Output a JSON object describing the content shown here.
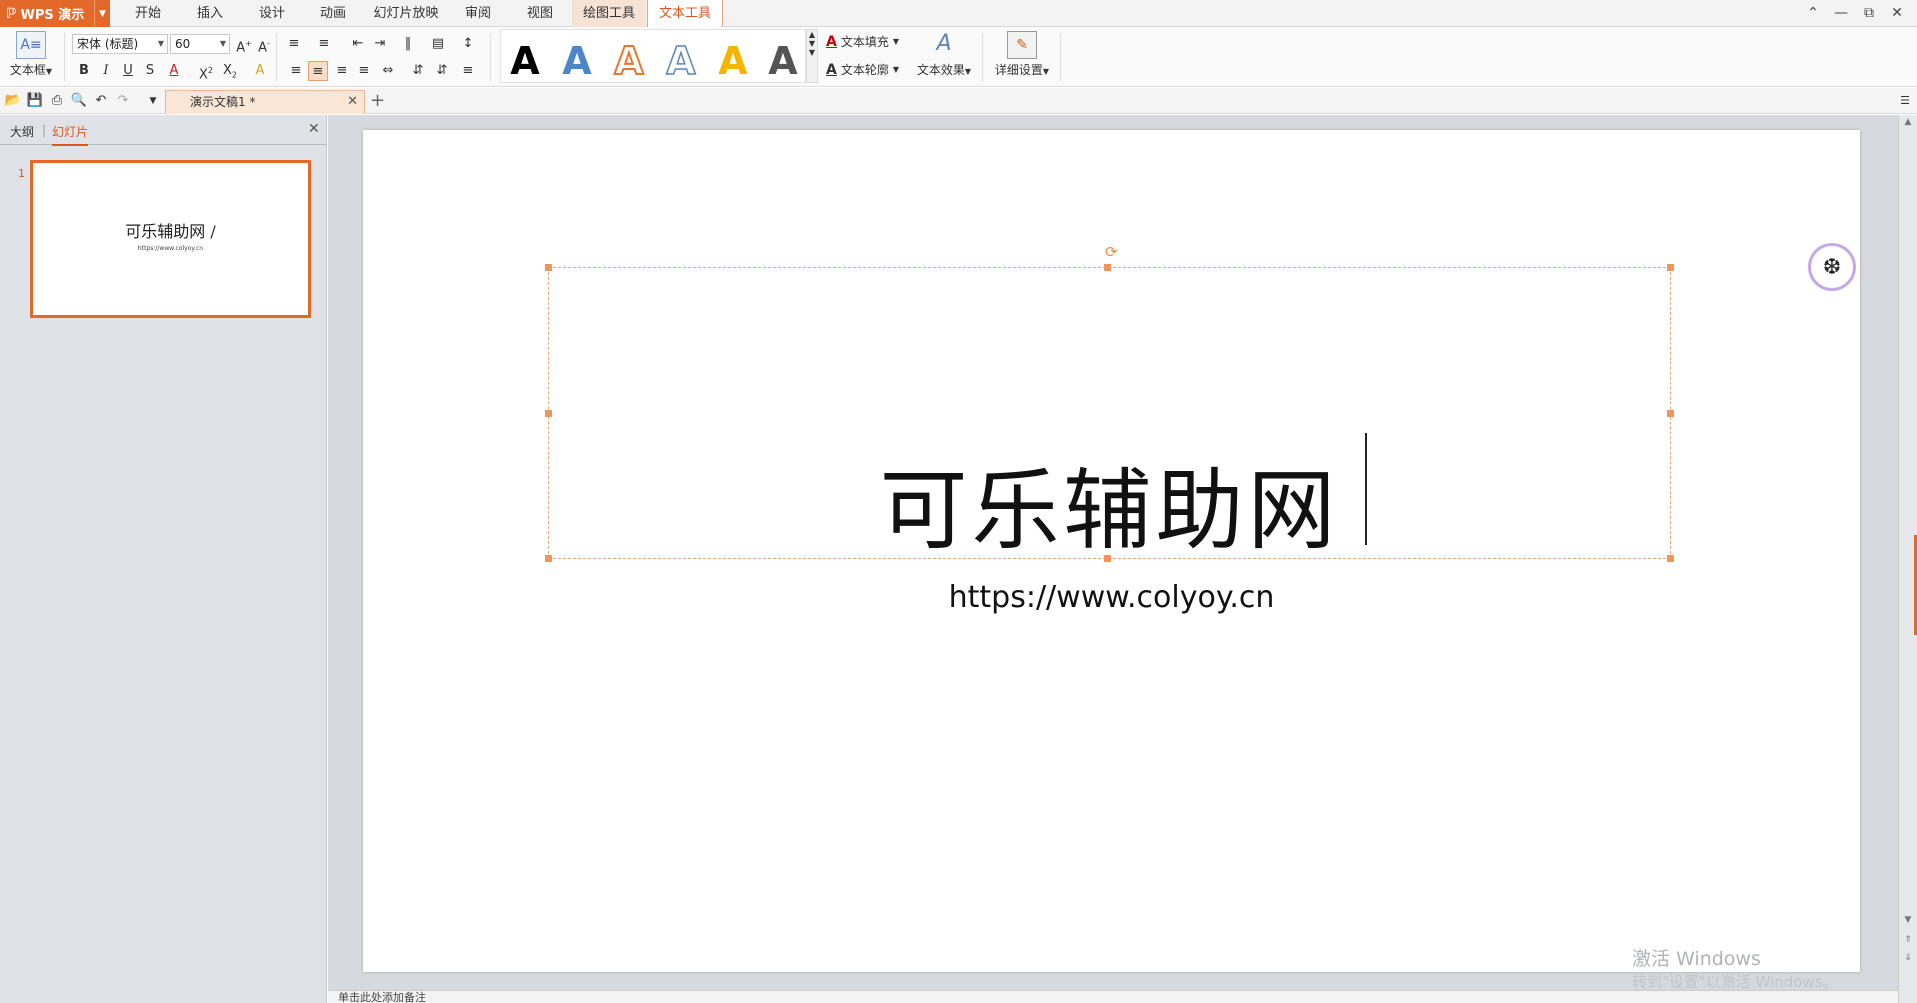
{
  "menubar": {
    "app_name": "WPS 演示",
    "tabs": [
      "开始",
      "插入",
      "设计",
      "动画",
      "幻灯片放映",
      "审阅",
      "视图"
    ],
    "context_tabs": [
      "绘图工具",
      "文本工具"
    ],
    "active_tab": "文本工具"
  },
  "ribbon": {
    "textbox_label": "文本框",
    "font_name": "宋体 (标题)",
    "font_size": "60",
    "text_fill": "文本填充",
    "text_outline": "文本轮廓",
    "text_effect": "文本效果",
    "detail_settings": "详细设置",
    "wordart_letter": "A"
  },
  "quickbar": {
    "doc_tab_title": "演示文稿1 *"
  },
  "left_pane": {
    "tab_outline": "大纲",
    "tab_slides": "幻灯片",
    "slide_number": "1",
    "thumb_title": "可乐辅助网 /",
    "thumb_subtitle": "https://www.colyoy.cn"
  },
  "slide": {
    "title": "可乐辅助网",
    "subtitle": "https://www.colyoy.cn"
  },
  "notes": {
    "placeholder": "单击此处添加备注"
  },
  "watermark": {
    "line1": "激活 Windows",
    "line2": "转到\"设置\"以激活 Windows。"
  },
  "colors": {
    "accent": "#e2692a",
    "selection_handle": "#f0955a"
  }
}
